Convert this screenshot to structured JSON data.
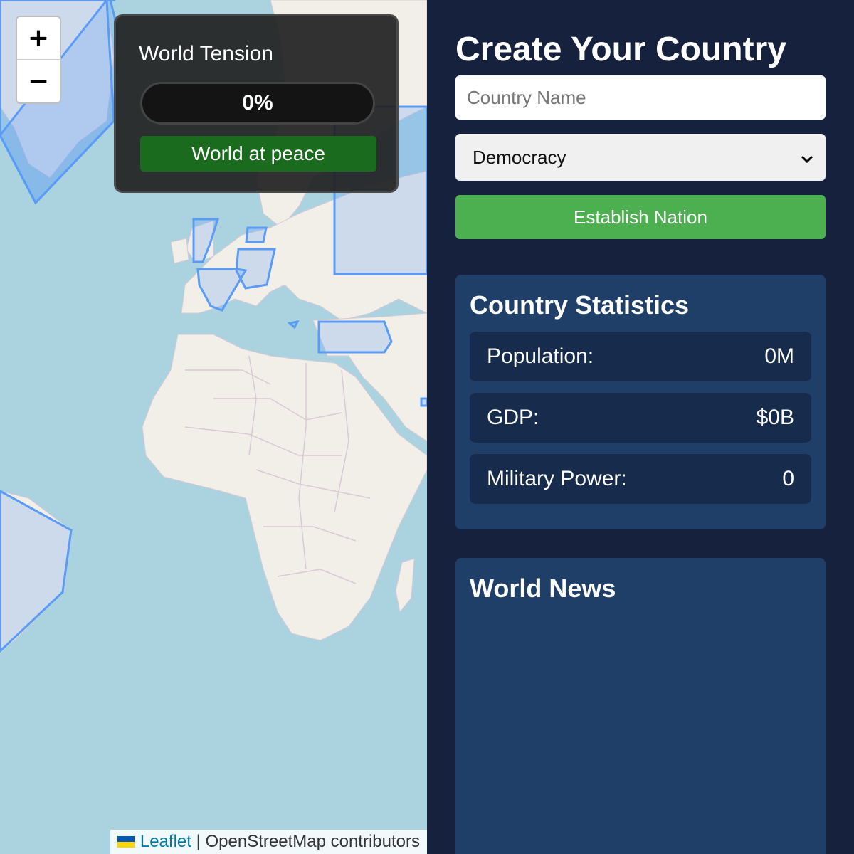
{
  "map": {
    "zoom_in_label": "+",
    "zoom_out_label": "−",
    "land_color": "#f2efe9",
    "water_color": "#aad3df",
    "region_outline_color": "#5a9bf6",
    "attribution": {
      "leaflet_label": "Leaflet",
      "separator": " | ",
      "osm_label": "OpenStreetMap contributors"
    }
  },
  "tension": {
    "title": "World Tension",
    "percent_label": "0%",
    "level": 0,
    "status": "World at peace",
    "status_color": "#1b6b1f"
  },
  "create": {
    "title": "Create Your Country",
    "name_placeholder": "Country Name",
    "name_value": "",
    "government_selected": "Democracy",
    "establish_label": "Establish Nation",
    "establish_color": "#4caf50"
  },
  "stats": {
    "title": "Country Statistics",
    "rows": [
      {
        "label": "Population:",
        "value": "0M"
      },
      {
        "label": "GDP:",
        "value": "$0B"
      },
      {
        "label": "Military Power:",
        "value": "0"
      }
    ]
  },
  "news": {
    "title": "World News"
  }
}
